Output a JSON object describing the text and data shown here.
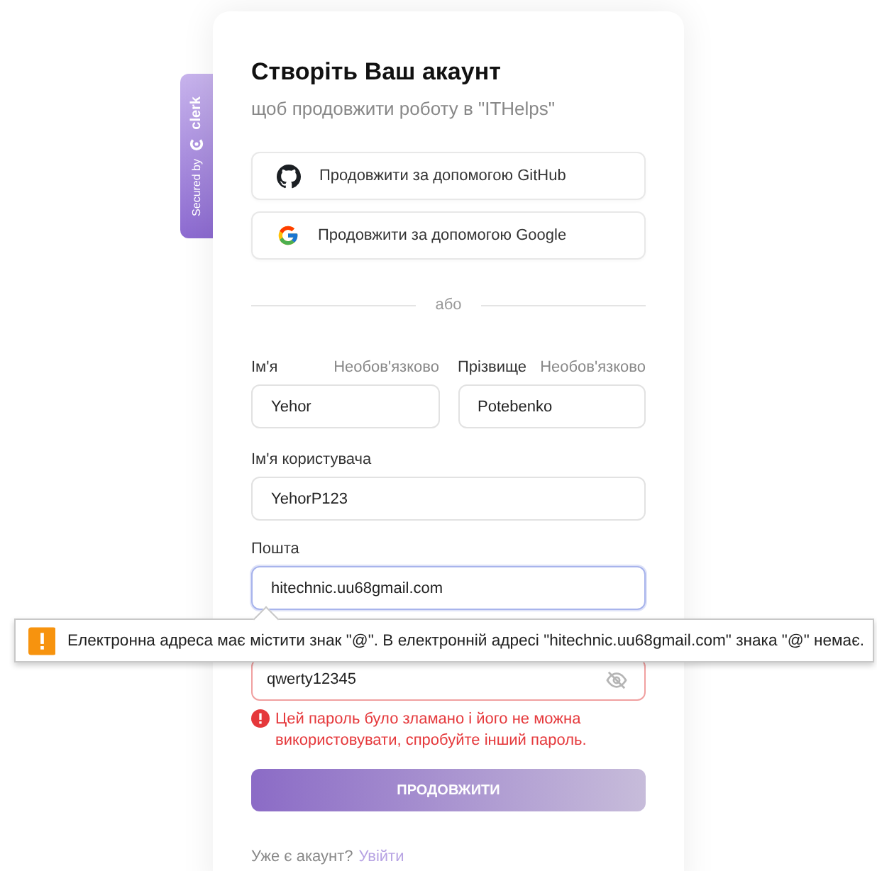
{
  "badge": {
    "text": "Secured by",
    "brand": "clerk"
  },
  "card": {
    "title": "Створіть Ваш акаунт",
    "subtitle": "щоб продовжити роботу в \"ITHelps\""
  },
  "social_buttons": [
    {
      "kind": "github",
      "label": "Продовжити за допомогою GitHub"
    },
    {
      "kind": "google",
      "label": "Продовжити за допомогою Google"
    }
  ],
  "divider": "або",
  "name_fields": [
    {
      "label": "Ім'я",
      "hint": "Необов'язково",
      "value": "Yehor"
    },
    {
      "label": "Прізвище",
      "hint": "Необов'язково",
      "value": "Potebenko"
    }
  ],
  "fields": [
    {
      "label": "Ім'я користувача",
      "value": "YehorP123",
      "focused": false
    },
    {
      "label": "Пошта",
      "value": "hitechnic.uu68gmail.com",
      "focused": true
    }
  ],
  "password": {
    "value": "qwerty12345",
    "error": true,
    "error_text": "Цей пароль було зламано і його не можна використовувати, спробуйте інший пароль."
  },
  "tooltip": {
    "text": "Електронна адреса має містити знак \"@\". В електронній адресі \"hitechnic.uu68gmail.com\" знака \"@\" немає."
  },
  "submit": "ПРОДОВЖИТИ",
  "footer": {
    "text": "Уже є акаунт?",
    "link": "Увійти"
  }
}
